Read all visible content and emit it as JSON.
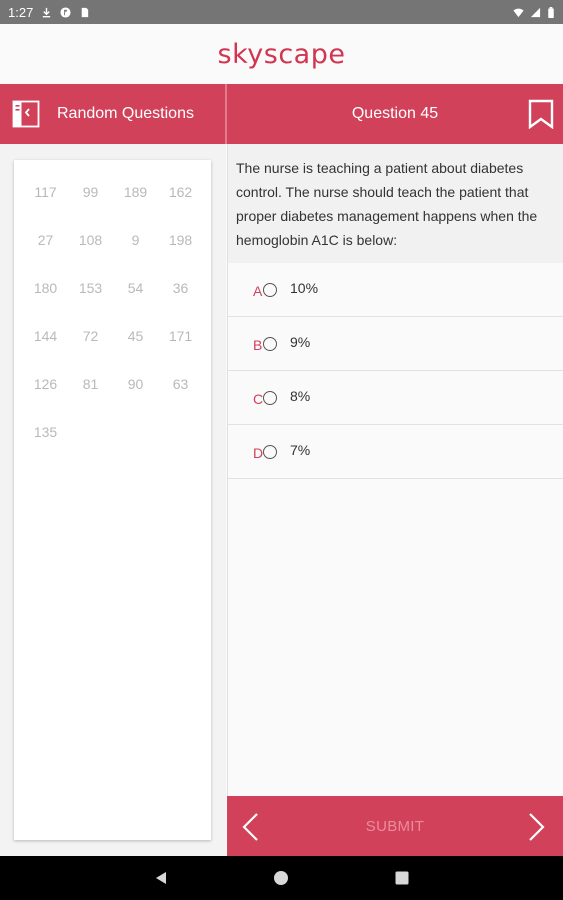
{
  "status": {
    "time": "1:27"
  },
  "app": {
    "logo": "skyscape",
    "accent": "#d2415a"
  },
  "header": {
    "left_title": "Random Questions",
    "question_title": "Question 45"
  },
  "question_list": [
    "117",
    "99",
    "189",
    "162",
    "27",
    "108",
    "9",
    "198",
    "180",
    "153",
    "54",
    "36",
    "144",
    "72",
    "45",
    "171",
    "126",
    "81",
    "90",
    "63",
    "135"
  ],
  "question": {
    "text": "The nurse is teaching a patient about diabetes control. The nurse should teach the patient that proper diabetes management happens when the hemoglobin A1C is below:",
    "options": [
      {
        "letter": "A",
        "text": "10%"
      },
      {
        "letter": "B",
        "text": "9%"
      },
      {
        "letter": "C",
        "text": "8%"
      },
      {
        "letter": "D",
        "text": "7%"
      }
    ]
  },
  "footer": {
    "submit_label": "SUBMIT"
  },
  "icons": {
    "book": "book-icon",
    "bookmark": "bookmark-icon",
    "prev": "chevron-left-icon",
    "next": "chevron-right-icon"
  }
}
